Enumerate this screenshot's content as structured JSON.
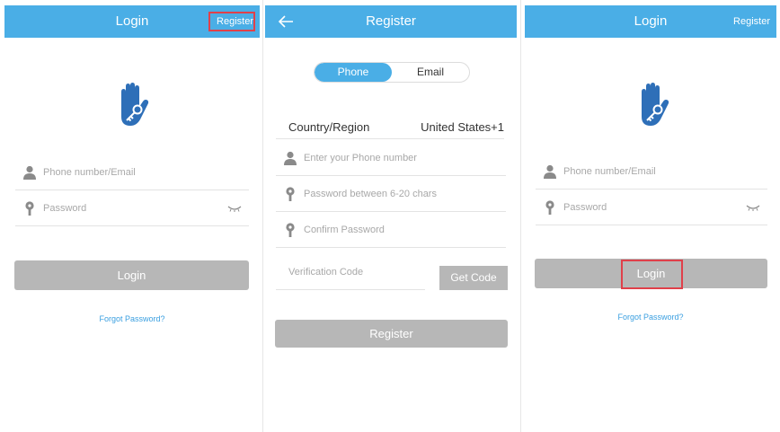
{
  "screen1": {
    "title": "Login",
    "register_link": "Register",
    "fields": {
      "account_placeholder": "Phone number/Email",
      "password_placeholder": "Password"
    },
    "login_button": "Login",
    "forgot_link": "Forgot Password?"
  },
  "screen2": {
    "title": "Register",
    "tabs": [
      {
        "label": "Phone",
        "selected": true
      },
      {
        "label": "Email",
        "selected": false
      }
    ],
    "country_label": "Country/Region",
    "country_value": "United States+1",
    "fields": {
      "phone_placeholder": "Enter your Phone number",
      "password_placeholder": "Password between 6-20 chars",
      "confirm_placeholder": "Confirm Password",
      "code_placeholder": "Verification Code"
    },
    "get_code_button": "Get Code",
    "register_button": "Register"
  },
  "screen3": {
    "title": "Login",
    "register_link": "Register",
    "fields": {
      "account_placeholder": "Phone number/Email",
      "password_placeholder": "Password"
    },
    "login_button": "Login",
    "forgot_link": "Forgot Password?"
  },
  "colors": {
    "topbar": "#4aaee6",
    "brand_icon": "#2e6fb8",
    "button_disabled": "#b7b7b7",
    "link": "#3a9fe0",
    "highlight": "#e0404a"
  },
  "icons": {
    "brand": "hand-key-icon",
    "user": "user-icon",
    "password": "key-pin-icon",
    "visibility": "eye-closed-icon",
    "back": "back-arrow-icon"
  }
}
